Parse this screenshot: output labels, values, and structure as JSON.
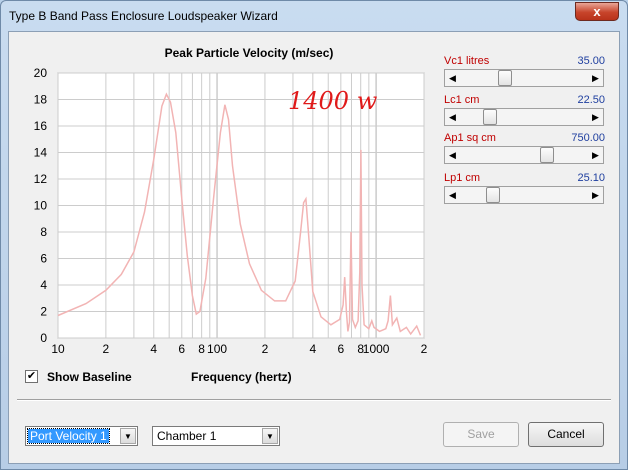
{
  "window": {
    "title": "Type B Band Pass Enclosure Loudspeaker Wizard",
    "close_glyph": "x"
  },
  "controls": [
    {
      "label": "Vc1  litres",
      "value": "35.00",
      "position": 0.33
    },
    {
      "label": "Lc1  cm",
      "value": "22.50",
      "position": 0.2
    },
    {
      "label": "Ap1  sq cm",
      "value": "750.00",
      "position": 0.7
    },
    {
      "label": "Lp1  cm",
      "value": "25.10",
      "position": 0.23
    }
  ],
  "baseline": {
    "label": "Show Baseline",
    "checked": true
  },
  "bottom": {
    "plot_select": {
      "selected": "Port Velocity 1"
    },
    "chamber_select": {
      "selected": "Chamber 1"
    },
    "save_label": "Save",
    "cancel_label": "Cancel"
  },
  "annotation": "1400 w",
  "colors": {
    "curve": "#f2b4b4",
    "grid": "#cccccc",
    "label_red": "#c00000",
    "value_blue": "#1f3f9f",
    "annotation": "#e01a1a"
  },
  "chart_data": {
    "type": "line",
    "title": "Peak Particle Velocity (m/sec)",
    "xlabel": "Frequency (hertz)",
    "ylabel": "",
    "x_scale": "log",
    "xlim": [
      10,
      2000
    ],
    "ylim": [
      0,
      20
    ],
    "grid": true,
    "y_ticks": [
      0,
      2,
      4,
      6,
      8,
      10,
      12,
      14,
      16,
      18,
      20
    ],
    "x_ticks": [
      {
        "value": 10,
        "label": "10"
      },
      {
        "value": 20,
        "label": "2"
      },
      {
        "value": 40,
        "label": "4"
      },
      {
        "value": 60,
        "label": "6"
      },
      {
        "value": 80,
        "label": "8"
      },
      {
        "value": 100,
        "label": "100"
      },
      {
        "value": 200,
        "label": "2"
      },
      {
        "value": 400,
        "label": "4"
      },
      {
        "value": 600,
        "label": "6"
      },
      {
        "value": 800,
        "label": "8"
      },
      {
        "value": 1000,
        "label": "1000"
      },
      {
        "value": 2000,
        "label": "2"
      }
    ],
    "series": [
      {
        "values": [
          [
            10,
            1.7
          ],
          [
            15,
            2.6
          ],
          [
            20,
            3.6
          ],
          [
            25,
            4.8
          ],
          [
            30,
            6.5
          ],
          [
            35,
            9.5
          ],
          [
            40,
            13.5
          ],
          [
            45,
            17.5
          ],
          [
            48,
            18.4
          ],
          [
            51,
            17.8
          ],
          [
            55,
            15.5
          ],
          [
            60,
            10.5
          ],
          [
            65,
            6.2
          ],
          [
            70,
            3.2
          ],
          [
            74,
            1.8
          ],
          [
            78,
            2.0
          ],
          [
            85,
            4.5
          ],
          [
            95,
            10.5
          ],
          [
            105,
            15.5
          ],
          [
            112,
            17.6
          ],
          [
            118,
            16.5
          ],
          [
            125,
            13.0
          ],
          [
            140,
            8.6
          ],
          [
            160,
            5.6
          ],
          [
            190,
            3.6
          ],
          [
            230,
            2.8
          ],
          [
            270,
            2.8
          ],
          [
            310,
            4.3
          ],
          [
            335,
            8.0
          ],
          [
            350,
            10.2
          ],
          [
            362,
            10.5
          ],
          [
            375,
            8.0
          ],
          [
            400,
            3.5
          ],
          [
            450,
            1.6
          ],
          [
            520,
            1.0
          ],
          [
            590,
            1.4
          ],
          [
            620,
            2.5
          ],
          [
            635,
            4.6
          ],
          [
            650,
            2.0
          ],
          [
            665,
            0.5
          ],
          [
            680,
            1.2
          ],
          [
            695,
            8.0
          ],
          [
            710,
            1.4
          ],
          [
            740,
            0.8
          ],
          [
            770,
            1.3
          ],
          [
            790,
            5.0
          ],
          [
            802,
            14.2
          ],
          [
            815,
            4.0
          ],
          [
            840,
            1.0
          ],
          [
            900,
            0.7
          ],
          [
            940,
            1.3
          ],
          [
            970,
            0.8
          ],
          [
            1050,
            0.5
          ],
          [
            1150,
            0.7
          ],
          [
            1190,
            1.3
          ],
          [
            1230,
            3.2
          ],
          [
            1265,
            1.0
          ],
          [
            1350,
            1.5
          ],
          [
            1420,
            0.5
          ],
          [
            1550,
            0.8
          ],
          [
            1650,
            0.3
          ],
          [
            1800,
            0.9
          ],
          [
            1900,
            0.2
          ]
        ]
      }
    ]
  }
}
